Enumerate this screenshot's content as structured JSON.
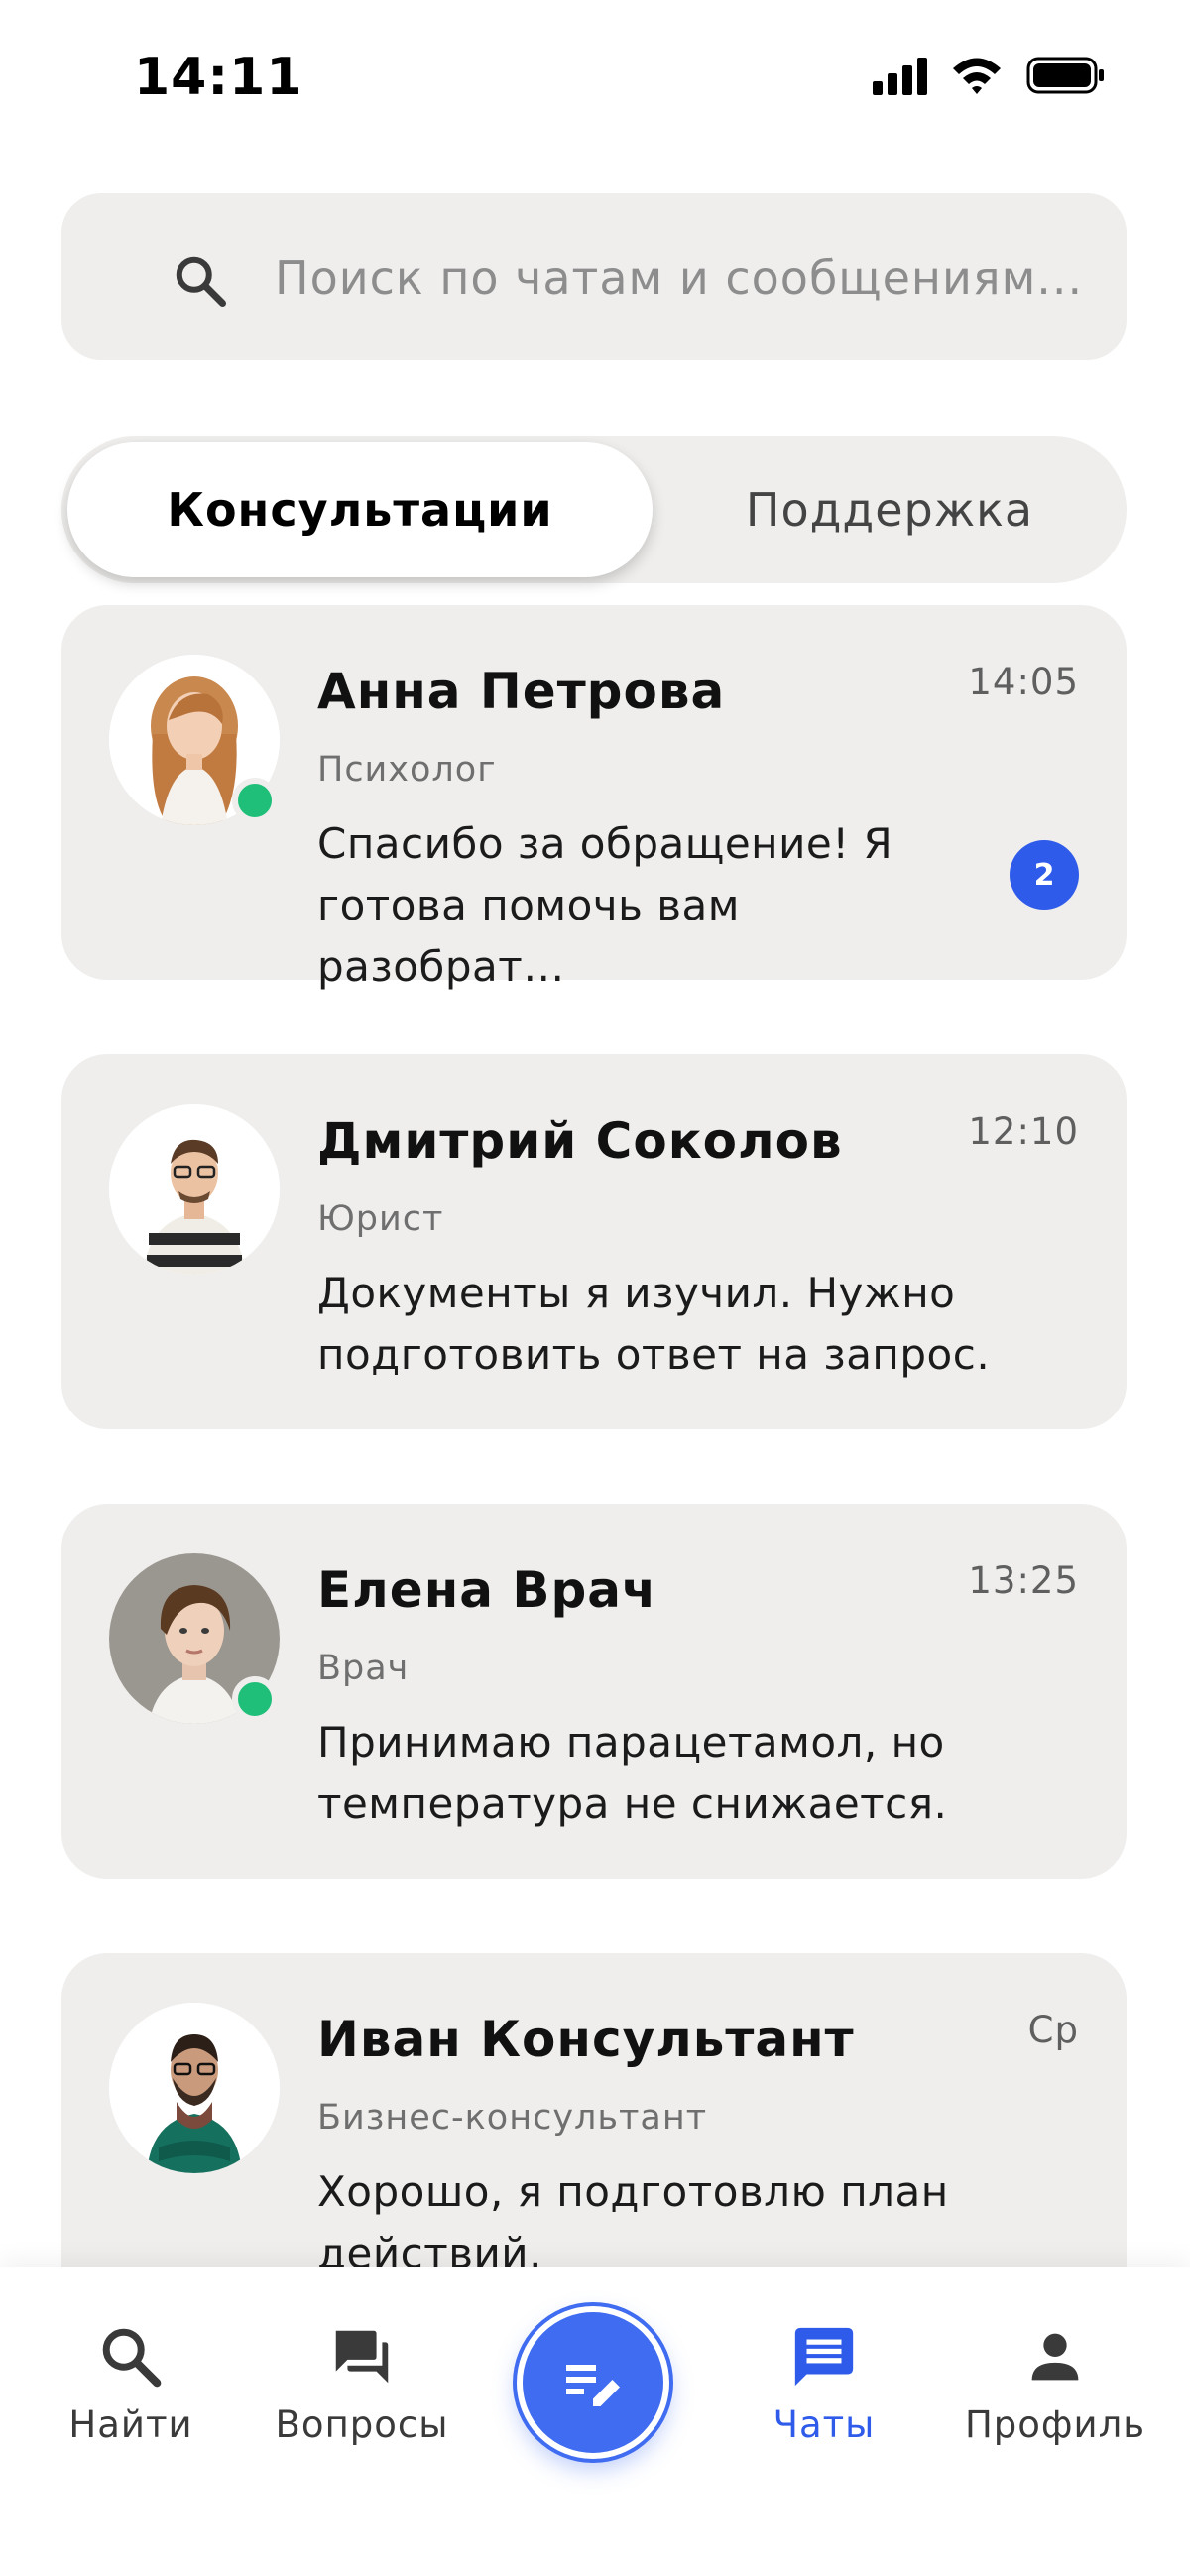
{
  "status_bar": {
    "time": "14:11"
  },
  "search": {
    "placeholder": "Поиск по чатам и сообщениям..."
  },
  "tabs": [
    {
      "label": "Консультации",
      "active": true
    },
    {
      "label": "Поддержка",
      "active": false
    }
  ],
  "chats": [
    {
      "name": "Анна Петрова",
      "role": "Психолог",
      "message": "Спасибо за обращение! Я готова помочь вам разобрат…",
      "time": "14:05",
      "unread": "2",
      "online": true
    },
    {
      "name": "Дмитрий Соколов",
      "role": "Юрист",
      "message": "Документы я изучил. Нужно подготовить ответ на запрос.",
      "time": "12:10",
      "online": false
    },
    {
      "name": "Елена Врач",
      "role": "Врач",
      "message": "Принимаю парацетамол, но температура не снижается.",
      "time": "13:25",
      "online": true
    },
    {
      "name": "Иван Консультант",
      "role": "Бизнес-консультант",
      "message": "Хорошо, я подготовлю план действий.",
      "time": "Ср",
      "online": false
    }
  ],
  "bottom_nav": {
    "items": [
      {
        "label": "Найти",
        "icon": "search-icon"
      },
      {
        "label": "Вопросы",
        "icon": "forum-icon"
      },
      {
        "label": "Чаты",
        "icon": "chat-icon",
        "active": true
      },
      {
        "label": "Профиль",
        "icon": "person-icon"
      }
    ],
    "fab_icon": "edit-note-icon"
  },
  "colors": {
    "accent": "#2f5bea",
    "online": "#1fbf7a",
    "card_bg": "#efeeec"
  }
}
